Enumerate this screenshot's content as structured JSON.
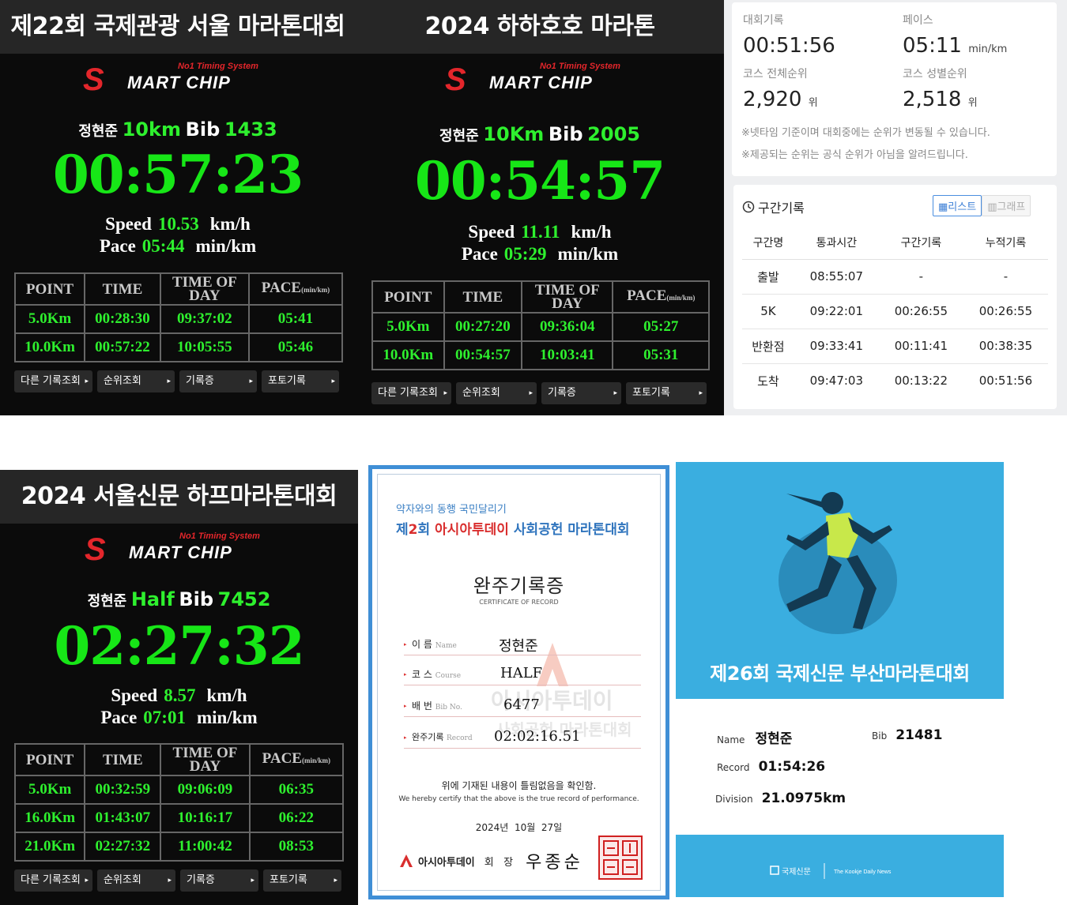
{
  "panel1": {
    "title": "제22회 국제관광 서울 마라톤대회",
    "logo_top": "No1 Timing System",
    "logo_main": "MART CHIP",
    "logo_s": "S",
    "name": "정현준",
    "distance": "10km",
    "bib_label": "Bib",
    "bib": "1433",
    "time": "00:57:23",
    "speed_label": "Speed",
    "speed": "10.53",
    "speed_unit": "km/h",
    "pace_label": "Pace",
    "pace": "05:44",
    "pace_unit": "min/km",
    "headers": [
      "POINT",
      "TIME",
      "TIME OF",
      "DAY",
      "PACE",
      "(min/km)"
    ],
    "rows": [
      [
        "5.0Km",
        "00:28:30",
        "09:37:02",
        "05:41"
      ],
      [
        "10.0Km",
        "00:57:22",
        "10:05:55",
        "05:46"
      ]
    ],
    "buttons": [
      "다른 기록조회",
      "순위조회",
      "기록증",
      "포토기록"
    ]
  },
  "panel2": {
    "title": "2024 하하호호 마라톤",
    "logo_top": "No1 Timing System",
    "logo_main": "MART CHIP",
    "logo_s": "S",
    "name": "정현준",
    "distance": "10Km",
    "bib_label": "Bib",
    "bib": "2005",
    "time": "00:54:57",
    "speed_label": "Speed",
    "speed": "11.11",
    "speed_unit": "km/h",
    "pace_label": "Pace",
    "pace": "05:29",
    "pace_unit": "min/km",
    "headers": [
      "POINT",
      "TIME",
      "TIME OF",
      "DAY",
      "PACE",
      "(min/km)"
    ],
    "rows": [
      [
        "5.0Km",
        "00:27:20",
        "09:36:04",
        "05:27"
      ],
      [
        "10.0Km",
        "00:54:57",
        "10:03:41",
        "05:31"
      ]
    ],
    "buttons": [
      "다른 기록조회",
      "순위조회",
      "기록증",
      "포토기록"
    ]
  },
  "panel3": {
    "title": "2024 서울신문 하프마라톤대회",
    "logo_top": "No1 Timing System",
    "logo_main": "MART CHIP",
    "logo_s": "S",
    "name": "정현준",
    "distance": "Half",
    "bib_label": "Bib",
    "bib": "7452",
    "time": "02:27:32",
    "speed_label": "Speed",
    "speed": "8.57",
    "speed_unit": "km/h",
    "pace_label": "Pace",
    "pace": "07:01",
    "pace_unit": "min/km",
    "headers": [
      "POINT",
      "TIME",
      "TIME OF",
      "DAY",
      "PACE",
      "(min/km)"
    ],
    "rows": [
      [
        "5.0Km",
        "00:32:59",
        "09:06:09",
        "06:35"
      ],
      [
        "16.0Km",
        "01:43:07",
        "10:16:17",
        "06:22"
      ],
      [
        "21.0Km",
        "02:27:32",
        "11:00:42",
        "08:53"
      ]
    ],
    "buttons": [
      "다른 기록조회",
      "순위조회",
      "기록증",
      "포토기록"
    ]
  },
  "record_summary": {
    "race_record_label": "대회기록",
    "race_record": "00:51:56",
    "pace_label": "페이스",
    "pace": "05:11",
    "pace_unit": "min/km",
    "overall_rank_label": "코스 전체순위",
    "overall_rank": "2,920",
    "rank_unit": "위",
    "gender_rank_label": "코스 성별순위",
    "gender_rank": "2,518",
    "note1": "※넷타임 기준이며 대회중에는 순위가 변동될 수 있습니다.",
    "note2": "※제공되는 순위는 공식 순위가 아님을 알려드립니다."
  },
  "segments": {
    "title": "구간기록",
    "tab_list": "리스트",
    "tab_graph": "그래프",
    "headers": [
      "구간명",
      "통과시간",
      "구간기록",
      "누적기록"
    ],
    "rows": [
      [
        "출발",
        "08:55:07",
        "-",
        "-"
      ],
      [
        "5K",
        "09:22:01",
        "00:26:55",
        "00:26:55"
      ],
      [
        "반환점",
        "09:33:41",
        "00:11:41",
        "00:38:35"
      ],
      [
        "도착",
        "09:47:03",
        "00:13:22",
        "00:51:56"
      ]
    ]
  },
  "certificate": {
    "slogan": "약자와의 동행 국민달리기",
    "event_prefix": "제",
    "event_num": "2",
    "event_mid": "회",
    "event_org": "아시아투데이",
    "event_name": "사회공헌 마라톤대회",
    "heading": "완주기록증",
    "heading_en": "CERTIFICATE OF RECORD",
    "fields": [
      {
        "ko": "이   름",
        "en": "Name",
        "value": "정현준"
      },
      {
        "ko": "코   스",
        "en": "Course",
        "value": "HALF"
      },
      {
        "ko": "배   번",
        "en": "Bib No.",
        "value": "6477"
      },
      {
        "ko": "완주기록",
        "en": "Record",
        "value": "02:02:16.51"
      }
    ],
    "confirm_ko": "위에 기재된 내용이 틀림없음을 확인함.",
    "confirm_en": "We hereby certify that the above is the true record of performance.",
    "date": "2024년  10월  27일",
    "issuer_org": "아시아투데이",
    "issuer_title": "회   장",
    "issuer_name": "우종순",
    "watermark_line1": "아시아투데이",
    "watermark_line2": "사회공헌 마라톤대회"
  },
  "busan": {
    "title": "제26회 국제신문 부산마라톤대회",
    "name_label": "Name",
    "name": "정현준",
    "bib_label": "Bib",
    "bib": "21481",
    "record_label": "Record",
    "record": "01:54:26",
    "division_label": "Division",
    "division": "21.0975km",
    "footer_logo": "국제신문",
    "footer_en": "The Kookje Daily News"
  }
}
